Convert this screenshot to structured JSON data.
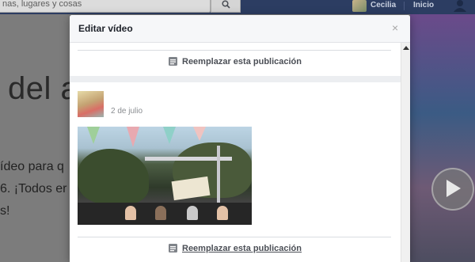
{
  "topbar": {
    "search_text": "nas, lugares y cosas",
    "user_name": "Cecilia",
    "home_label": "Inicio"
  },
  "background_page": {
    "title_fragment": "del a",
    "lines": [
      "ídeo para q",
      "6. ¡Todos er",
      "s!"
    ]
  },
  "dialog": {
    "title": "Editar vídeo",
    "close_label": "×",
    "replace_label_top": "Reemplazar esta publicación",
    "post_date": "2 de julio",
    "replace_label_bottom": "Reemplazar esta publicación"
  },
  "colors": {
    "topbar": "#2c3d62",
    "dialog_bg": "#f6f7f9",
    "card_bg": "#ffffff",
    "replace_text": "#4b4f56"
  },
  "icons": {
    "search": "search-icon",
    "close": "close-icon",
    "document": "document-icon",
    "friends": "friends-icon",
    "play": "play-icon"
  }
}
